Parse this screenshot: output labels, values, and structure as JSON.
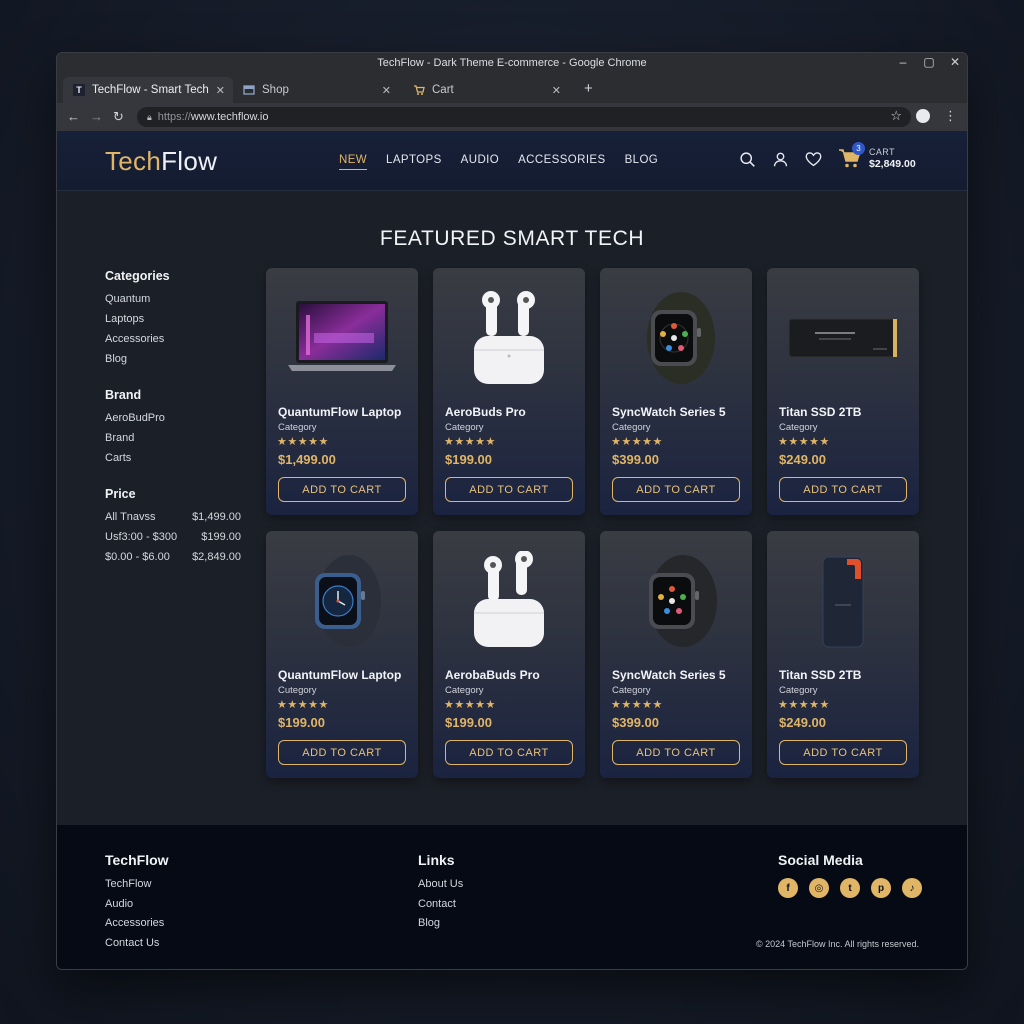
{
  "browser": {
    "window_title": "TechFlow - Dark Theme E-commerce - Google Chrome",
    "tabs": [
      {
        "label": "TechFlow - Smart Tech",
        "favicon": "T"
      },
      {
        "label": "Shop",
        "favicon": "shop-icon"
      },
      {
        "label": "Cart",
        "favicon": "cart-icon"
      }
    ],
    "url_protocol": "https://",
    "url_host": "www.techflow.io"
  },
  "header": {
    "logo_part1": "Tech",
    "logo_part2": "Flow",
    "nav": [
      "NEW",
      "LAPTOPS",
      "AUDIO",
      "ACCESSORIES",
      "BLOG"
    ],
    "cart_count": "3",
    "cart_label": "CART",
    "cart_total": "$2,849.00"
  },
  "section_title": "FEATURED SMART TECH",
  "sidebar": {
    "categories_heading": "Categories",
    "categories": [
      "Quantum",
      "Laptops",
      "Accessories",
      "Blog"
    ],
    "brand_heading": "Brand",
    "brands": [
      "AeroBudPro",
      "Brand",
      "Carts"
    ],
    "price_heading": "Price",
    "prices": [
      {
        "label": "All Tnavss",
        "value": "$1,499.00"
      },
      {
        "label": "Usf3:00 - $300",
        "value": "$199.00"
      },
      {
        "label": "$0.00 - $6.00",
        "value": "$2,849.00"
      }
    ]
  },
  "products": [
    {
      "name": "QuantumFlow Laptop",
      "category": "Category",
      "stars": "★★★★★",
      "price": "$1,499.00",
      "button": "ADD TO CART",
      "image": "laptop"
    },
    {
      "name": "AeroBuds Pro",
      "category": "Category",
      "stars": "★★★★★",
      "price": "$199.00",
      "button": "ADD TO CART",
      "image": "earbuds"
    },
    {
      "name": "SyncWatch Series 5",
      "category": "Category",
      "stars": "★★★★★",
      "price": "$399.00",
      "button": "ADD TO CART",
      "image": "watch"
    },
    {
      "name": "Titan SSD 2TB",
      "category": "Category",
      "stars": "★★★★★",
      "price": "$249.00",
      "button": "ADD TO CART",
      "image": "ssd"
    },
    {
      "name": "QuantumFlow Laptop",
      "category": "Cutegory",
      "stars": "★★★★★",
      "price": "$199.00",
      "button": "ADD TO CART",
      "image": "watch-blue"
    },
    {
      "name": "AerobaBuds Pro",
      "category": "Category",
      "stars": "★★★★★",
      "price": "$199.00",
      "button": "ADD TO CART",
      "image": "earbuds"
    },
    {
      "name": "SyncWatch Series 5",
      "category": "Category",
      "stars": "★★★★★",
      "price": "$399.00",
      "button": "ADD TO CART",
      "image": "watch"
    },
    {
      "name": "Titan SSD 2TB",
      "category": "Category",
      "stars": "★★★★★",
      "price": "$249.00",
      "button": "ADD TO CART",
      "image": "ssd-portable"
    }
  ],
  "footer": {
    "col1_heading": "TechFlow",
    "col1_items": [
      "TechFlow",
      "Audio",
      "Accessories",
      "Contact Us"
    ],
    "col2_heading": "Links",
    "col2_items": [
      "About Us",
      "Contact",
      "Blog"
    ],
    "social_heading": "Social Media",
    "socials": [
      "facebook-icon",
      "instagram-icon",
      "twitter-icon",
      "pinterest-icon",
      "tiktok-icon"
    ],
    "copyright": "© 2024 TechFlow Inc. All rights reserved."
  },
  "colors": {
    "accent": "#e1b566",
    "header_bg": "#162038",
    "footer_bg": "#060a15"
  }
}
